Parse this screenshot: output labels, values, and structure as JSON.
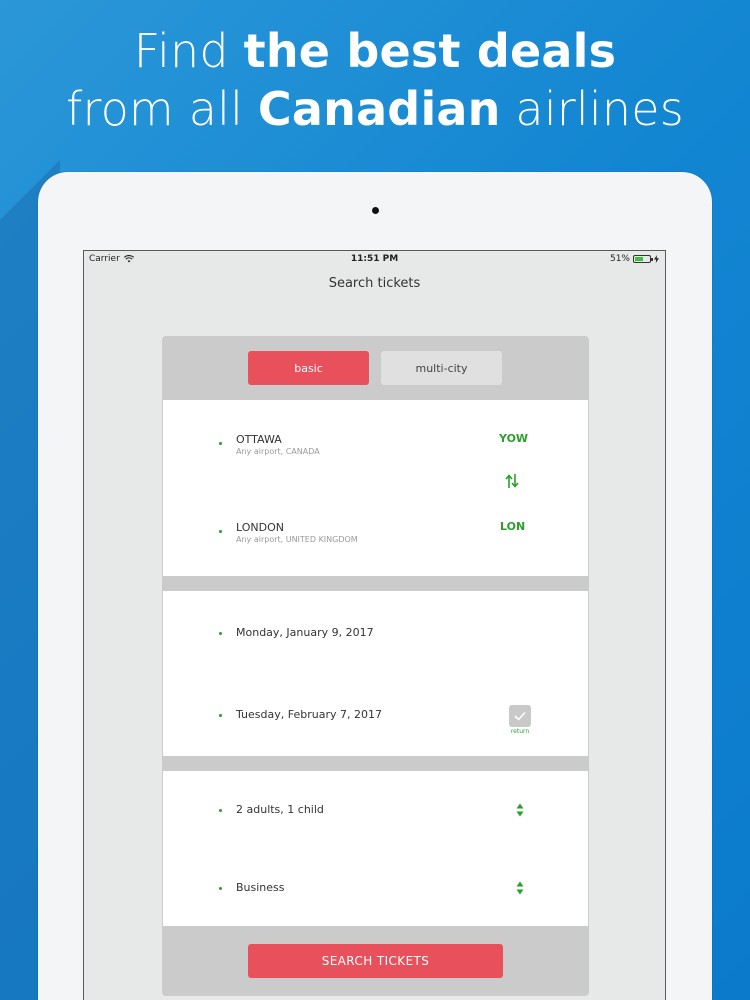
{
  "headline": {
    "line1_light": "Find ",
    "line1_bold": "the best deals",
    "line2_light": "from all ",
    "line2_bold": "Canadian",
    "line2_tail": " airlines"
  },
  "status_bar": {
    "carrier": "Carrier",
    "time": "11:51 PM",
    "battery": "51%"
  },
  "nav": {
    "title": "Search tickets"
  },
  "segments": {
    "basic": "basic",
    "multi_city": "multi-city",
    "selected": "basic"
  },
  "route": {
    "from": {
      "city": "OTTAWA",
      "detail": "Any airport, CANADA",
      "code": "YOW"
    },
    "to": {
      "city": "LONDON",
      "detail": "Any airport, UNITED KINGDOM",
      "code": "LON"
    }
  },
  "dates": {
    "depart": "Monday, January 9, 2017",
    "return": "Tuesday, February 7, 2017",
    "return_label": "return"
  },
  "passengers": {
    "label": "2 adults, 1 child"
  },
  "cabin": {
    "label": "Business"
  },
  "search_button": "SEARCH TICKETS",
  "colors": {
    "accent_red": "#e8505b",
    "accent_green": "#2aa02a",
    "background_blue": "#1386d2"
  }
}
